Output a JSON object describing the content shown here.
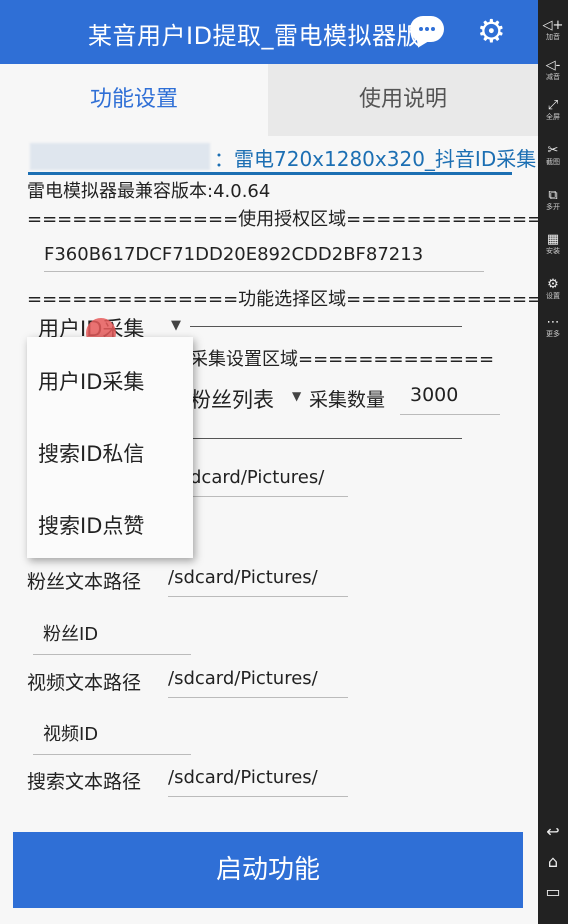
{
  "header": {
    "title": "某音用户ID提取_雷电模拟器版",
    "accent": "#2f6fd6",
    "icons": [
      "chat-icon",
      "gear-icon"
    ]
  },
  "tabs": [
    {
      "label": "功能设置",
      "active": true
    },
    {
      "label": "使用说明",
      "active": false
    }
  ],
  "device": {
    "label": "：雷电720x1280x320_抖音ID采集"
  },
  "version_line": "雷电模拟器最兼容版本:4.0.64",
  "auth": {
    "header": "==============使用授权区域==============",
    "key": "F360B617DCF71DD20E892CDD2BF87213"
  },
  "function_area": {
    "header": "==============功能选择区域==============",
    "selected": "用户ID采集",
    "options": [
      "用户ID采集",
      "搜索ID私信",
      "搜索ID点赞"
    ]
  },
  "collect_settings": {
    "header_partial": "采集设置区域=============",
    "list_type": "粉丝列表",
    "count_label": "采集数量",
    "count_value": "3000"
  },
  "paths": {
    "partial_path": "dcard/Pictures/",
    "fans_label": "粉丝文本路径",
    "fans_path": "/sdcard/Pictures/",
    "fans_name": "粉丝ID",
    "video_label": "视频文本路径",
    "video_path": "/sdcard/Pictures/",
    "video_name": "视频ID",
    "search_label": "搜索文本路径",
    "search_path": "/sdcard/Pictures/"
  },
  "start_button": "启动功能",
  "sidebar": [
    {
      "icon": "volume-up-icon",
      "glyph": "◁+",
      "label": "加音"
    },
    {
      "icon": "volume-down-icon",
      "glyph": "◁-",
      "label": "减音"
    },
    {
      "icon": "fullscreen-icon",
      "glyph": "⤢",
      "label": "全屏"
    },
    {
      "icon": "scissors-icon",
      "glyph": "✂",
      "label": "截图"
    },
    {
      "icon": "multi-open-icon",
      "glyph": "⧉",
      "label": "多开"
    },
    {
      "icon": "apk-icon",
      "glyph": "▦",
      "label": "安装"
    },
    {
      "icon": "settings-icon",
      "glyph": "⚙",
      "label": "设置"
    },
    {
      "icon": "more-icon",
      "glyph": "⋯",
      "label": "更多"
    }
  ],
  "sidebar_nav": [
    {
      "icon": "back-icon",
      "glyph": "↩"
    },
    {
      "icon": "home-icon",
      "glyph": "⌂"
    },
    {
      "icon": "recent-apps-icon",
      "glyph": "▭"
    }
  ]
}
